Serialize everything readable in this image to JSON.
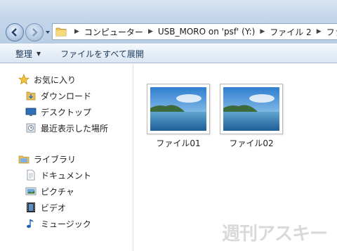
{
  "address": {
    "crumbs": [
      "コンピューター",
      "USB_MORO on 'psf' (Y:)",
      "ファイル 2",
      "ファイ"
    ]
  },
  "toolbar": {
    "organize_label": "整理",
    "share_label": "ファイルをすべて展開"
  },
  "sidebar": {
    "favorites": {
      "header": "お気に入り",
      "items": [
        {
          "label": "ダウンロード",
          "icon": "folder-download-icon"
        },
        {
          "label": "デスクトップ",
          "icon": "desktop-icon"
        },
        {
          "label": "最近表示した場所",
          "icon": "recent-places-icon"
        }
      ]
    },
    "libraries": {
      "header": "ライブラリ",
      "items": [
        {
          "label": "ドキュメント",
          "icon": "documents-icon"
        },
        {
          "label": "ピクチャ",
          "icon": "pictures-icon"
        },
        {
          "label": "ビデオ",
          "icon": "videos-icon"
        },
        {
          "label": "ミュージック",
          "icon": "music-icon"
        }
      ]
    }
  },
  "files": [
    {
      "name": "ファイル01"
    },
    {
      "name": "ファイル02"
    }
  ],
  "watermark": "週刊アスキー"
}
